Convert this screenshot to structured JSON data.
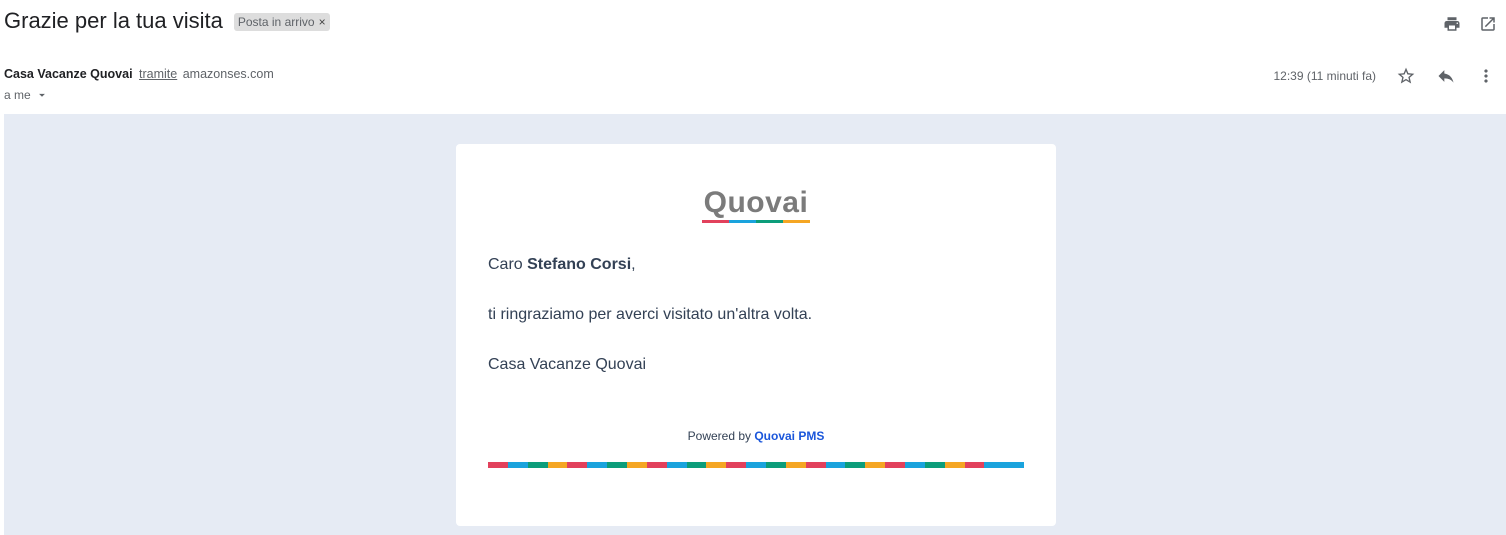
{
  "header": {
    "subject": "Grazie per la tua visita",
    "label_chip": "Posta in arrivo",
    "chip_close": "×",
    "print_icon": "print-icon",
    "open_new_window_icon": "open-in-new-icon"
  },
  "sender": {
    "name": "Casa Vacanze Quovai",
    "via_label": "tramite",
    "via_domain": "amazonses.com",
    "to_label": "a me",
    "timestamp": "12:39 (11 minuti fa)"
  },
  "message": {
    "logo_text": "Quovai",
    "greeting_prefix": "Caro ",
    "recipient_name": "Stefano Corsi",
    "greeting_suffix": ",",
    "body_line": "ti ringraziamo per averci visitato un'altra volta.",
    "signature": "Casa Vacanze Quovai",
    "powered_by_prefix": "Powered by ",
    "powered_by_link": "Quovai PMS"
  },
  "colors": {
    "stripe": [
      "#e2415c",
      "#1aa3dd",
      "#0c9d7a",
      "#f5a623",
      "#e2415c",
      "#1aa3dd",
      "#0c9d7a",
      "#f5a623",
      "#e2415c",
      "#1aa3dd",
      "#0c9d7a",
      "#f5a623",
      "#e2415c",
      "#1aa3dd",
      "#0c9d7a",
      "#f5a623",
      "#e2415c",
      "#1aa3dd",
      "#0c9d7a",
      "#f5a623",
      "#e2415c",
      "#1aa3dd",
      "#0c9d7a",
      "#f5a623",
      "#e2415c",
      "#1aa3dd",
      "#1aa3dd"
    ],
    "logo_bar": [
      "#e2415c",
      "#1aa3dd",
      "#0c9d7a",
      "#f5a623"
    ],
    "body_bg": "#e6ebf4",
    "link": "#1a56db"
  }
}
